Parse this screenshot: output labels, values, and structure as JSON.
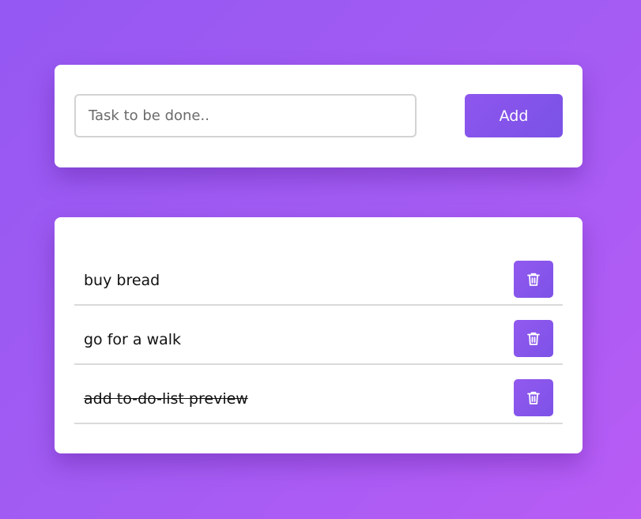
{
  "input_section": {
    "placeholder": "Task to be done..",
    "value": "",
    "add_label": "Add"
  },
  "tasks": [
    {
      "text": "buy bread",
      "completed": false,
      "delete_icon": "trash-icon"
    },
    {
      "text": "go for a walk",
      "completed": false,
      "delete_icon": "trash-icon"
    },
    {
      "text": "add to-do-list preview",
      "completed": true,
      "delete_icon": "trash-icon"
    }
  ],
  "colors": {
    "accent": "#8355ec",
    "background_start": "#9558f2",
    "background_end": "#b85cf5",
    "card": "#ffffff",
    "divider": "#dadada"
  }
}
